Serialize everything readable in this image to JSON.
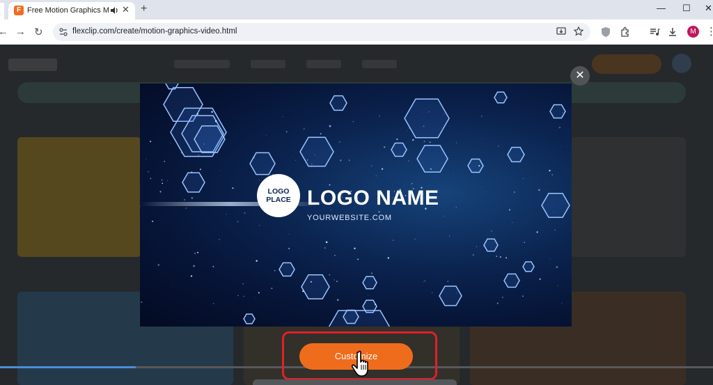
{
  "browser": {
    "tab_title": "Free Motion Graphics Make",
    "favicon_letter": "F",
    "url": "flexclip.com/create/motion-graphics-video.html",
    "profile_initial": "M",
    "window_controls": {
      "minimize": "—",
      "maximize": "☐",
      "close": "✕"
    },
    "nav": {
      "back": "←",
      "forward": "→",
      "reload": "↻"
    },
    "new_tab": "+",
    "tab_close": "✕",
    "menu": "⋮"
  },
  "modal": {
    "close_label": "✕",
    "preview": {
      "logo_placeholder": "LOGO PLACE",
      "logo_name": "LOGO NAME",
      "website": "YOURWEBSITE.COM"
    },
    "customize_label": "Customize",
    "video_progress": 0.19
  },
  "colors": {
    "accent_orange": "#ef6c1c",
    "highlight_red": "#e0202a",
    "progress_blue": "#4a8fd8"
  },
  "icons": [
    "audio-icon",
    "site-settings-icon",
    "install-app-icon",
    "bookmark-star-icon",
    "shield-icon",
    "extensions-icon",
    "media-controls-icon",
    "download-icon",
    "hand-cursor-icon"
  ]
}
